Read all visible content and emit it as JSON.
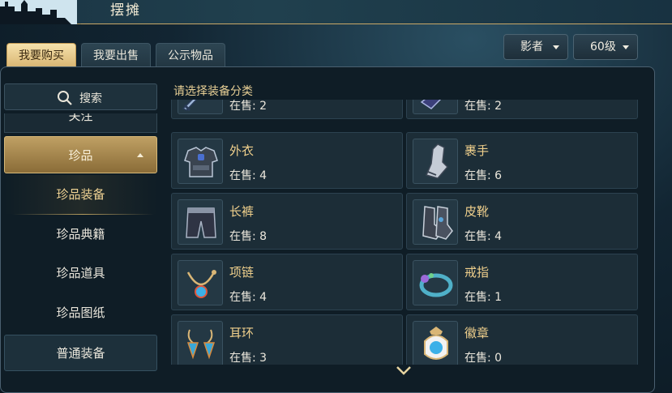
{
  "header": {
    "title": "摆摊"
  },
  "tabs": [
    {
      "label": "我要购买",
      "active": true
    },
    {
      "label": "我要出售",
      "active": false
    },
    {
      "label": "公示物品",
      "active": false
    }
  ],
  "filters": {
    "class_label": "影者",
    "level_label": "60级"
  },
  "search": {
    "label": "搜索"
  },
  "sidebar": {
    "partial_label": "关注",
    "category": "珍品",
    "subitems": [
      {
        "label": "珍品装备",
        "selected": true
      },
      {
        "label": "珍品典籍",
        "selected": false
      },
      {
        "label": "珍品道具",
        "selected": false
      },
      {
        "label": "珍品图纸",
        "selected": false
      }
    ],
    "bottom": "普通装备"
  },
  "main": {
    "hint": "请选择装备分类",
    "items": [
      {
        "name": "",
        "stock": "在售: 2",
        "icon": "sword-icon"
      },
      {
        "name": "",
        "stock": "在售: 2",
        "icon": "weapon-icon"
      },
      {
        "name": "外衣",
        "stock": "在售: 4",
        "icon": "chest-armor-icon"
      },
      {
        "name": "裹手",
        "stock": "在售: 6",
        "icon": "gauntlet-icon"
      },
      {
        "name": "长裤",
        "stock": "在售: 8",
        "icon": "pants-icon"
      },
      {
        "name": "皮靴",
        "stock": "在售: 4",
        "icon": "boots-icon"
      },
      {
        "name": "项链",
        "stock": "在售: 4",
        "icon": "necklace-icon"
      },
      {
        "name": "戒指",
        "stock": "在售: 1",
        "icon": "ring-icon"
      },
      {
        "name": "耳环",
        "stock": "在售: 3",
        "icon": "earring-icon"
      },
      {
        "name": "徽章",
        "stock": "在售: 0",
        "icon": "badge-icon"
      }
    ]
  },
  "colors": {
    "accent_gold": "#d8b572",
    "name_text": "#f0d08c",
    "panel_bg": "#0f1d26"
  }
}
